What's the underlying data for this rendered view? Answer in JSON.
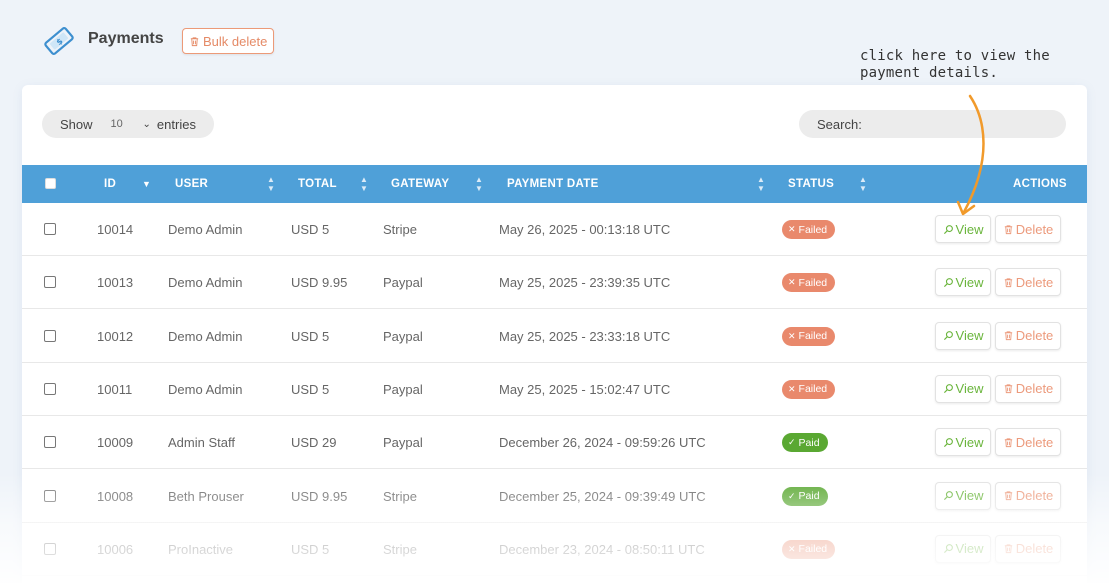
{
  "header": {
    "title": "Payments",
    "bulk_delete_label": "Bulk delete",
    "logo_icon": "payment-ticket-icon"
  },
  "annotation": {
    "line1": "click here to view the",
    "line2": "payment details."
  },
  "controls": {
    "show_label": "Show",
    "entries_value": "10",
    "entries_label": "entries",
    "search_label": "Search:",
    "search_value": ""
  },
  "table": {
    "columns": [
      "ID",
      "USER",
      "TOTAL",
      "GATEWAY",
      "PAYMENT DATE",
      "STATUS",
      "ACTIONS"
    ],
    "rows": [
      {
        "id": "10014",
        "user": "Demo Admin",
        "total": "USD 5",
        "gateway": "Stripe",
        "date": "May 26, 2025 - 00:13:18 UTC",
        "status": "Failed"
      },
      {
        "id": "10013",
        "user": "Demo Admin",
        "total": "USD 9.95",
        "gateway": "Paypal",
        "date": "May 25, 2025 - 23:39:35 UTC",
        "status": "Failed"
      },
      {
        "id": "10012",
        "user": "Demo Admin",
        "total": "USD 5",
        "gateway": "Paypal",
        "date": "May 25, 2025 - 23:33:18 UTC",
        "status": "Failed"
      },
      {
        "id": "10011",
        "user": "Demo Admin",
        "total": "USD 5",
        "gateway": "Paypal",
        "date": "May 25, 2025 - 15:02:47 UTC",
        "status": "Failed"
      },
      {
        "id": "10009",
        "user": "Admin Staff",
        "total": "USD 29",
        "gateway": "Paypal",
        "date": "December 26, 2024 - 09:59:26 UTC",
        "status": "Paid"
      },
      {
        "id": "10008",
        "user": "Beth Prouser",
        "total": "USD 9.95",
        "gateway": "Stripe",
        "date": "December 25, 2024 - 09:39:49 UTC",
        "status": "Paid"
      },
      {
        "id": "10006",
        "user": "ProInactive",
        "total": "USD 5",
        "gateway": "Stripe",
        "date": "December 23, 2024 - 08:50:11 UTC",
        "status": "Failed"
      }
    ],
    "view_label": "View",
    "delete_label": "Delete"
  },
  "colors": {
    "header_bg": "#4fa0d8",
    "failed": "#e9896c",
    "paid": "#5aa832",
    "view": "#6ab53c",
    "delete": "#ec9a7c",
    "annotation_arrow": "#f19a2b"
  }
}
